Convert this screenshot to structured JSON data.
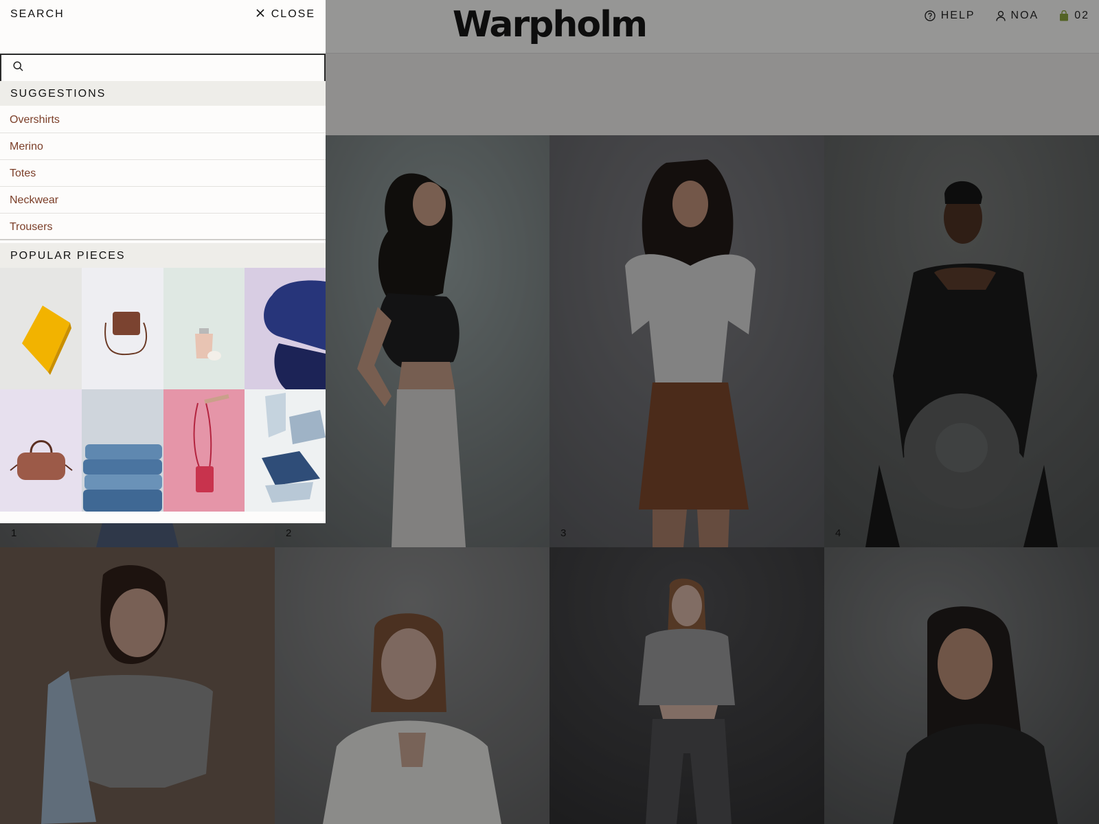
{
  "brand": {
    "logo": "Warpholm"
  },
  "topnav": {
    "help": "HELP",
    "account": "NOA",
    "bag_count": "02",
    "accent_green": "#8ba43a"
  },
  "search_drawer": {
    "title": "SEARCH",
    "close_label": "CLOSE",
    "input_value": "",
    "suggestions_heading": "SUGGESTIONS",
    "suggestions": [
      {
        "label": "Overshirts"
      },
      {
        "label": "Merino"
      },
      {
        "label": "Totes"
      },
      {
        "label": "Neckwear"
      },
      {
        "label": "Trousers"
      }
    ],
    "popular_heading": "POPULAR PIECES",
    "popular_pieces": [
      {
        "icon": "yellow-notebook"
      },
      {
        "icon": "brown-crossbody-bag"
      },
      {
        "icon": "perfume-bottle"
      },
      {
        "icon": "folded-blue-knitwear"
      },
      {
        "icon": "leather-duffle-bag"
      },
      {
        "icon": "stacked-denim-jeans"
      },
      {
        "icon": "pink-shoulder-bag"
      },
      {
        "icon": "folded-light-jeans"
      }
    ]
  },
  "grid": {
    "tiles": [
      {
        "number": "1"
      },
      {
        "number": "2"
      },
      {
        "number": "3"
      },
      {
        "number": "4"
      },
      {
        "number": ""
      },
      {
        "number": ""
      },
      {
        "number": ""
      },
      {
        "number": ""
      }
    ]
  },
  "colors": {
    "link": "#7b3e28",
    "overlay": "rgba(10,10,10,0.42)"
  }
}
